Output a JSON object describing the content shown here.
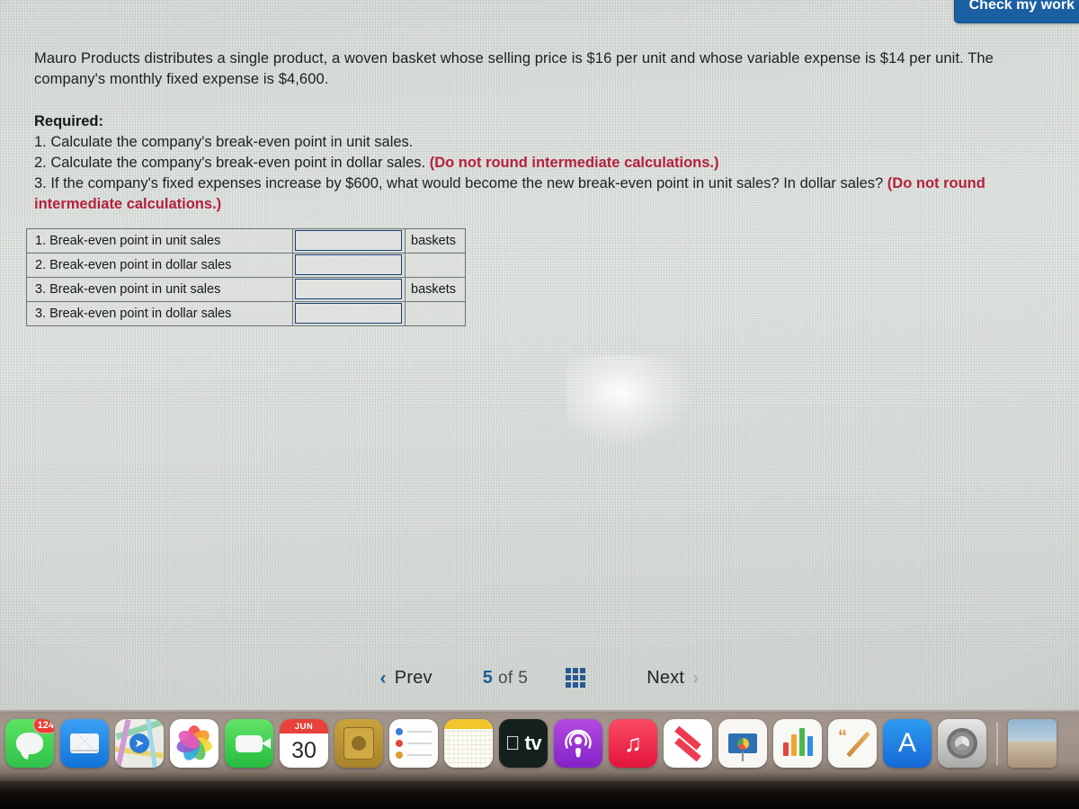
{
  "check_button": {
    "label": "Check my work"
  },
  "problem": {
    "paragraph": "Mauro Products distributes a single product, a woven basket whose selling price is $16 per unit and whose variable expense is $14 per unit. The company's monthly fixed expense is $4,600.",
    "required_heading": "Required:",
    "requirements": [
      {
        "plain": "1. Calculate the company's break-even point in unit sales.",
        "red": ""
      },
      {
        "plain": "2. Calculate the company's break-even point in dollar sales. ",
        "red": "(Do not round intermediate calculations.)"
      },
      {
        "plain": "3. If the company's fixed expenses increase by $600, what would become the new break-even point in unit sales? In dollar sales? ",
        "red": "(Do not round intermediate calculations.)"
      }
    ]
  },
  "answer_table": {
    "rows": [
      {
        "label": "1. Break-even point in unit sales",
        "value": "",
        "unit": "baskets"
      },
      {
        "label": "2. Break-even point in dollar sales",
        "value": "",
        "unit": ""
      },
      {
        "label": "3. Break-even point in unit sales",
        "value": "",
        "unit": "baskets"
      },
      {
        "label": "3. Break-even point in dollar sales",
        "value": "",
        "unit": ""
      }
    ]
  },
  "pager": {
    "prev_label": "Prev",
    "next_label": "Next",
    "current_page": "5",
    "of_label": "of",
    "total_pages": "5",
    "prev_chevron": "‹",
    "next_chevron": "›"
  },
  "dock": {
    "items": [
      {
        "name": "messages",
        "badge": "124",
        "glyph": ""
      },
      {
        "name": "mail",
        "badge": "",
        "glyph": ""
      },
      {
        "name": "maps",
        "badge": "",
        "glyph": "➤"
      },
      {
        "name": "photos",
        "badge": "",
        "glyph": ""
      },
      {
        "name": "facetime",
        "badge": "",
        "glyph": ""
      },
      {
        "name": "calendar",
        "badge": "",
        "glyph": "",
        "month": "JUN",
        "day": "30"
      },
      {
        "name": "contacts",
        "badge": "",
        "glyph": ""
      },
      {
        "name": "reminders",
        "badge": "",
        "glyph": ""
      },
      {
        "name": "notes",
        "badge": "",
        "glyph": ""
      },
      {
        "name": "apple-tv",
        "badge": "",
        "glyph": " tv"
      },
      {
        "name": "podcasts",
        "badge": "",
        "glyph": ""
      },
      {
        "name": "music",
        "badge": "",
        "glyph": "♫"
      },
      {
        "name": "news",
        "badge": "",
        "glyph": ""
      },
      {
        "name": "keynote",
        "badge": "",
        "glyph": ""
      },
      {
        "name": "numbers",
        "badge": "",
        "glyph": ""
      },
      {
        "name": "pages",
        "badge": "",
        "glyph": ""
      },
      {
        "name": "app-store",
        "badge": "",
        "glyph": "A"
      },
      {
        "name": "system-preferences",
        "badge": "",
        "glyph": ""
      },
      {
        "name": "photo-thumbnail",
        "badge": "",
        "glyph": ""
      }
    ]
  },
  "colors": {
    "accent_blue": "#1f5c99",
    "red_bold": "#b4213c",
    "input_border": "#1b3f70",
    "check_button_bg": "#1b5fa3"
  }
}
